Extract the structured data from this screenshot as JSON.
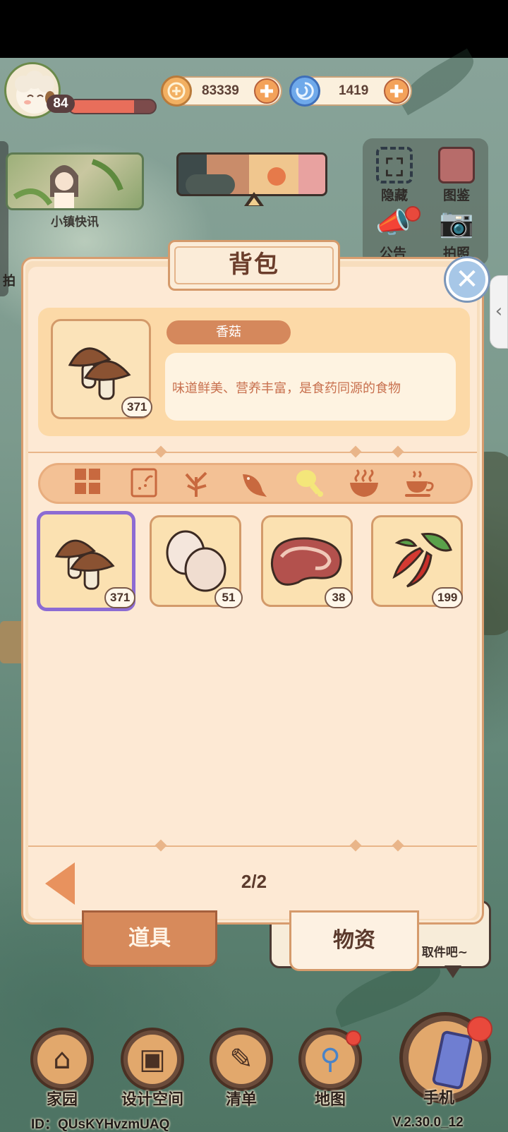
{
  "hud": {
    "level": "84",
    "xp_progress": 0.75,
    "gold": "83339",
    "gems": "1419"
  },
  "widgets": {
    "news_label": "小镇快讯",
    "hide_label": "隐藏",
    "catalog_label": "图鉴",
    "notice_label": "公告",
    "photo_label": "拍照",
    "left_peek_text": "拍"
  },
  "backpack": {
    "title": "背包",
    "selected_item": {
      "name": "香菇",
      "count": "371",
      "description": "味道鲜美、营养丰富，是食药同源的食物"
    },
    "filters": [
      "all-grid-icon",
      "seed-pack-icon",
      "plant-sprout-icon",
      "fish-icon",
      "drumstick-icon",
      "hot-bowl-icon",
      "tea-cup-icon"
    ],
    "items": [
      {
        "name": "mushroom",
        "count": "371"
      },
      {
        "name": "eggs",
        "count": "51"
      },
      {
        "name": "steak",
        "count": "38"
      },
      {
        "name": "chili-peppers",
        "count": "199"
      }
    ],
    "page": "2/2",
    "tabs": {
      "props": "道具",
      "materials": "物资"
    }
  },
  "chat": {
    "text": "取件吧~"
  },
  "nav": {
    "home": "家园",
    "design": "设计空间",
    "list": "清单",
    "map": "地图",
    "phone": "手机"
  },
  "footer": {
    "player_id": "ID：QUsKYHvzmUAQ",
    "version": "V.2.30.0_12"
  },
  "colors": {
    "accent_orange": "#d5885c",
    "selected_border": "#8c6bd3",
    "panel_bg": "#fde9d4"
  }
}
